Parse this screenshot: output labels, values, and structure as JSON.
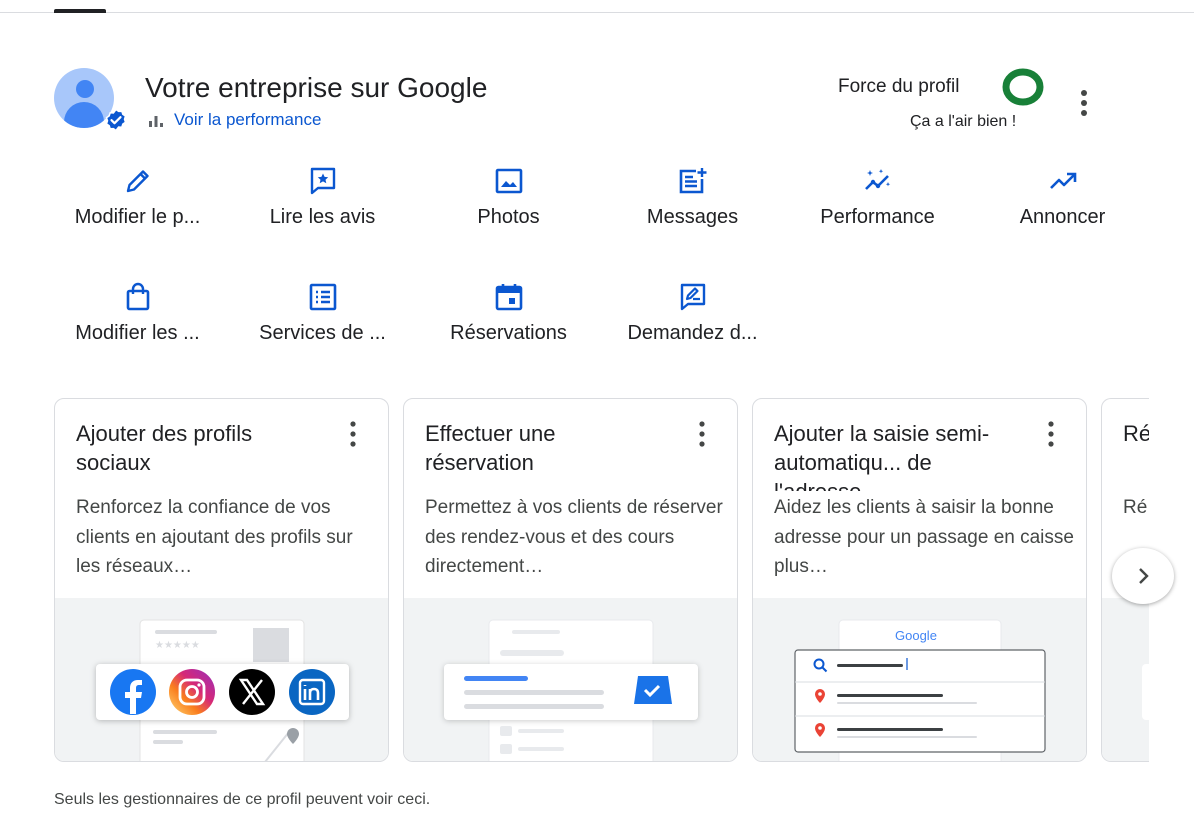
{
  "header": {
    "title": "Votre entreprise sur Google",
    "performance_link": "Voir la performance",
    "strength_label": "Force du profil",
    "strength_status": "Ça a l'air bien !",
    "strength_color": "#188038"
  },
  "actions": [
    {
      "label": "Modifier le p...",
      "icon": "pencil-icon"
    },
    {
      "label": "Lire les avis",
      "icon": "review-icon"
    },
    {
      "label": "Photos",
      "icon": "photo-icon"
    },
    {
      "label": "Messages",
      "icon": "messages-icon"
    },
    {
      "label": "Performance",
      "icon": "performance-icon"
    },
    {
      "label": "Annoncer",
      "icon": "trending-up-icon"
    },
    {
      "label": "Modifier les ...",
      "icon": "shopping-bag-icon"
    },
    {
      "label": "Services de ...",
      "icon": "list-icon"
    },
    {
      "label": "Réservations",
      "icon": "calendar-icon"
    },
    {
      "label": "Demandez d...",
      "icon": "request-review-icon"
    }
  ],
  "cards": [
    {
      "title": "Ajouter des profils sociaux",
      "description": "Renforcez la confiance de vos clients en ajoutant des profils sur les réseaux…"
    },
    {
      "title": "Effectuer une réservation",
      "description": "Permettez à vos clients de réserver des rendez-vous et des cours directement…"
    },
    {
      "title": "Ajouter la saisie semi-automatiqu... de l'adresse",
      "description": "Aidez les clients à saisir la bonne adresse pour un passage en caisse plus…"
    }
  ],
  "partial_card": {
    "title": "Ré cr",
    "description": "Ré 40"
  },
  "illustration": {
    "rating_stars": "★★★★★",
    "google_wordmark": "Google"
  },
  "footer_note": "Seuls les gestionnaires de ce profil peuvent voir ceci.",
  "colors": {
    "accent": "#0b57d0",
    "facebook": "#1877f2",
    "linkedin": "#0a66c2",
    "map_pin": "#ea4335"
  }
}
